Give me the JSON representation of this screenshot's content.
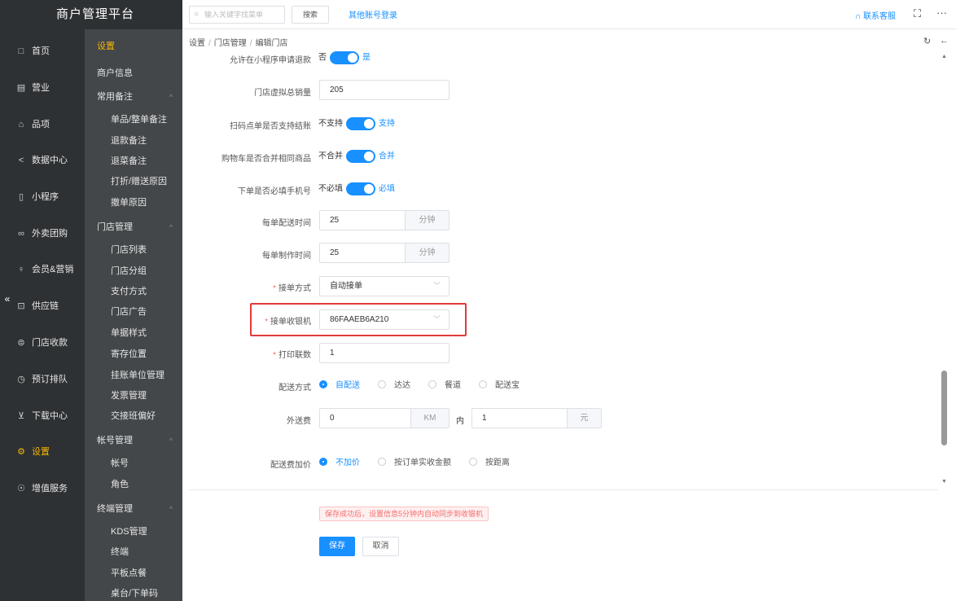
{
  "brand": "商户管理平台",
  "primary_nav": [
    {
      "label": "首页",
      "icon": "□"
    },
    {
      "label": "营业",
      "icon": "▤"
    },
    {
      "label": "品项",
      "icon": "⌂"
    },
    {
      "label": "数据中心",
      "icon": "<"
    },
    {
      "label": "小程序",
      "icon": "▯"
    },
    {
      "label": "外卖团购",
      "icon": "∞"
    },
    {
      "label": "会员&营销",
      "icon": "♀"
    },
    {
      "label": "供应链",
      "icon": "⊡"
    },
    {
      "label": "门店收款",
      "icon": "⊜"
    },
    {
      "label": "预订排队",
      "icon": "◷"
    },
    {
      "label": "下载中心",
      "icon": "⊻"
    },
    {
      "label": "设置",
      "icon": "⚙"
    },
    {
      "label": "增值服务",
      "icon": "☉"
    }
  ],
  "secondary_nav": [
    {
      "label": "设置",
      "type": "sec",
      "active": true
    },
    {
      "label": "商户信息",
      "type": "sec"
    },
    {
      "label": "常用备注",
      "type": "sec",
      "arrow": "^"
    },
    {
      "label": "单品/整单备注",
      "type": "sub"
    },
    {
      "label": "退款备注",
      "type": "sub"
    },
    {
      "label": "退菜备注",
      "type": "sub"
    },
    {
      "label": "打折/赠送原因",
      "type": "sub"
    },
    {
      "label": "撤单原因",
      "type": "sub"
    },
    {
      "label": "门店管理",
      "type": "sec",
      "arrow": "^"
    },
    {
      "label": "门店列表",
      "type": "sub"
    },
    {
      "label": "门店分组",
      "type": "sub"
    },
    {
      "label": "支付方式",
      "type": "sub"
    },
    {
      "label": "门店广告",
      "type": "sub"
    },
    {
      "label": "单据样式",
      "type": "sub"
    },
    {
      "label": "寄存位置",
      "type": "sub"
    },
    {
      "label": "挂账单位管理",
      "type": "sub"
    },
    {
      "label": "发票管理",
      "type": "sub"
    },
    {
      "label": "交接班偏好",
      "type": "sub"
    },
    {
      "label": "帐号管理",
      "type": "sec",
      "arrow": "^"
    },
    {
      "label": "帐号",
      "type": "sub"
    },
    {
      "label": "角色",
      "type": "sub"
    },
    {
      "label": "终端管理",
      "type": "sec",
      "arrow": "^"
    },
    {
      "label": "KDS管理",
      "type": "sub"
    },
    {
      "label": "终端",
      "type": "sub"
    },
    {
      "label": "平板点餐",
      "type": "sub"
    },
    {
      "label": "桌台/下单码",
      "type": "sub"
    }
  ],
  "header": {
    "search_placeholder": "输入关键字找菜单",
    "search_button": "搜索",
    "other_login": "其他账号登录",
    "contact": "联系客服"
  },
  "breadcrumb": [
    "设置",
    "门店管理",
    "编辑门店"
  ],
  "form": {
    "refund": {
      "label": "允许在小程序申请退款",
      "off": "否",
      "on": "是"
    },
    "virtual_sales": {
      "label": "门店虚拟总销量",
      "value": "205"
    },
    "scan_checkout": {
      "label": "扫码点单是否支持结账",
      "off": "不支持",
      "on": "支持"
    },
    "merge_cart": {
      "label": "购物车是否合并相同商品",
      "off": "不合并",
      "on": "合并"
    },
    "phone_required": {
      "label": "下单是否必填手机号",
      "off": "不必填",
      "on": "必填"
    },
    "delivery_time": {
      "label": "每单配送时间",
      "value": "25",
      "unit": "分钟"
    },
    "make_time": {
      "label": "每单制作时间",
      "value": "25",
      "unit": "分钟"
    },
    "accept_mode": {
      "label": "接单方式",
      "value": "自动接单"
    },
    "accept_cashier": {
      "label": "接单收银机",
      "value": "86FAAEB6A210"
    },
    "print_copies": {
      "label": "打印联数",
      "value": "1"
    },
    "delivery_mode": {
      "label": "配送方式",
      "options": [
        "自配送",
        "达达",
        "餐道",
        "配送宝"
      ],
      "selected": 0
    },
    "delivery_fee": {
      "label": "外送费",
      "distance": "0",
      "distance_unit": "KM",
      "within": "内",
      "fee": "1",
      "fee_unit": "元"
    },
    "fee_markup": {
      "label": "配送费加价",
      "options": [
        "不加价",
        "按订单实收金额",
        "按距离"
      ],
      "selected": 0
    }
  },
  "tip": "保存成功后，设置信息5分钟内自动同步到收银机",
  "actions": {
    "save": "保存",
    "cancel": "取消"
  },
  "colors": {
    "accent": "#1890ff",
    "active_nav": "#f7b500",
    "required": "#f56c6c",
    "highlight": "#e23a3a"
  }
}
